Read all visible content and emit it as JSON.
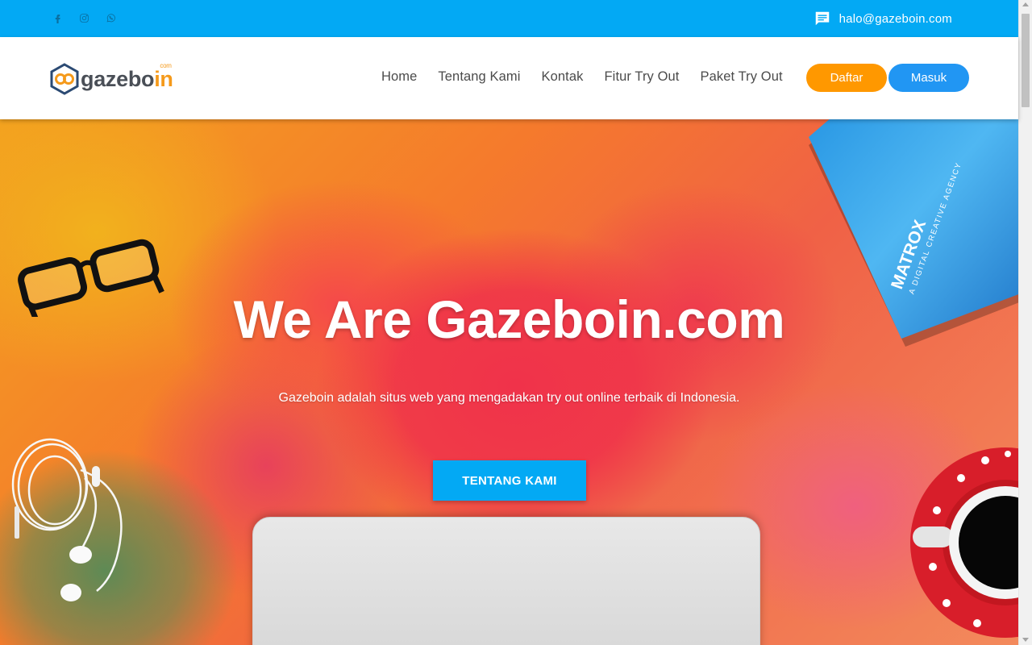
{
  "topbar": {
    "social_icons": [
      "facebook-icon",
      "instagram-icon",
      "whatsapp-icon"
    ],
    "email_icon": "chat-icon",
    "email": "halo@gazeboin.com"
  },
  "brand": {
    "name_main": "gazebo",
    "name_accent": "in",
    "superscript": "com"
  },
  "nav": {
    "items": [
      "Home",
      "Tentang Kami",
      "Kontak",
      "Fitur Try Out",
      "Paket Try Out"
    ],
    "daftar": "Daftar",
    "masuk": "Masuk"
  },
  "hero": {
    "title": "We Are Gazeboin.com",
    "subtitle": "Gazeboin adalah situs web yang mengadakan try out online terbaik di Indonesia.",
    "button": "TENTANG KAMI",
    "book_title": "MATROX",
    "book_subtitle": "A DIGITAL CREATIVE AGENCY"
  },
  "colors": {
    "topbar": "#03a9f4",
    "daftar": "#ff9800",
    "masuk": "#2196f3",
    "hero_button": "#03a9f4",
    "brand_accent": "#f59a1b"
  }
}
